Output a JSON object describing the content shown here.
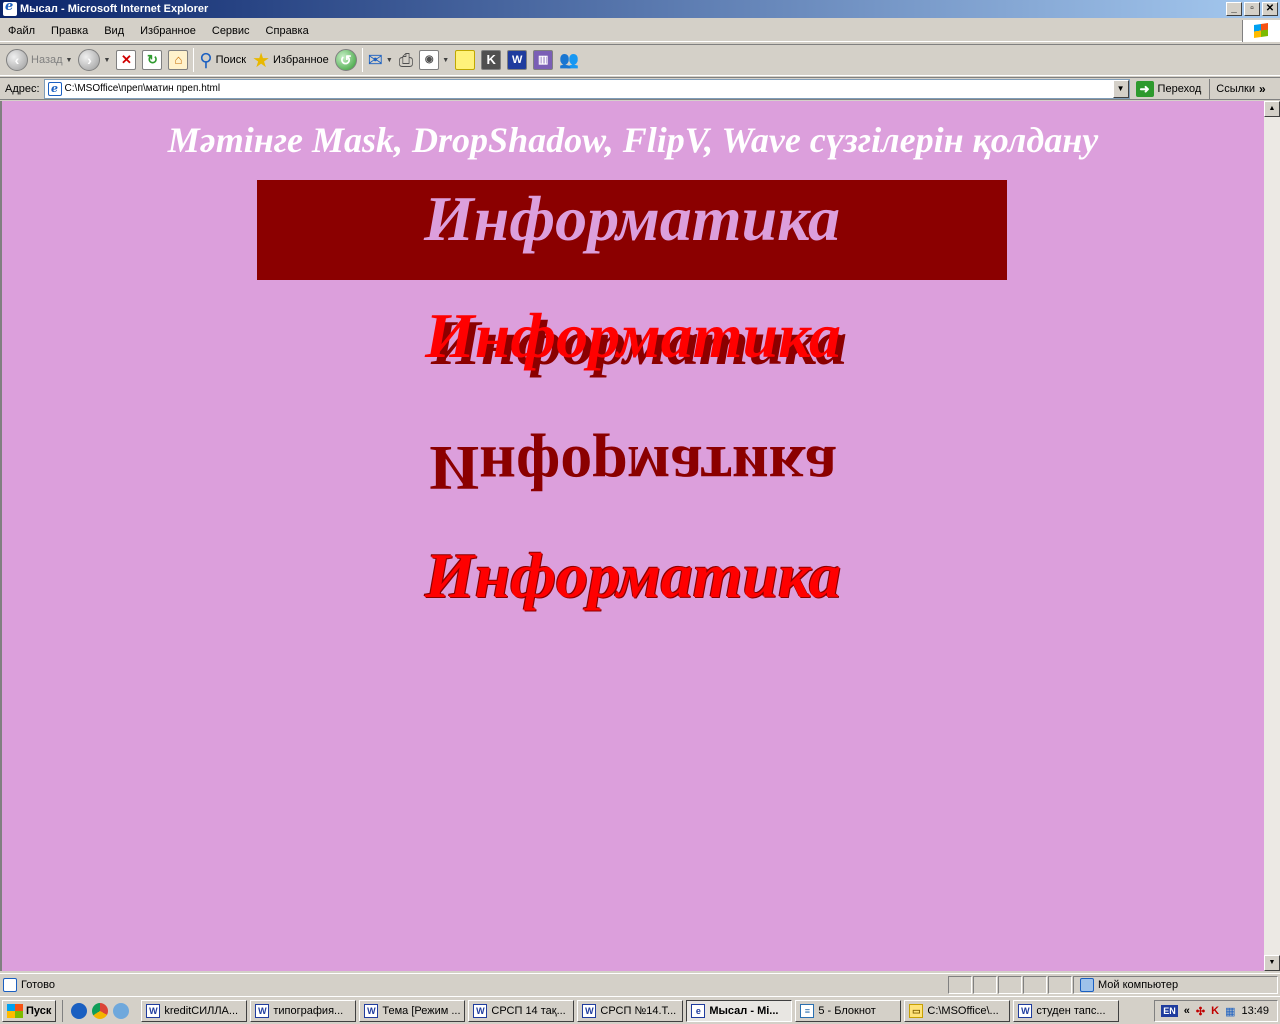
{
  "window": {
    "title": "Мысал - Microsoft Internet Explorer",
    "controls": [
      "_",
      "▫",
      "✕"
    ]
  },
  "menu": [
    "Файл",
    "Правка",
    "Вид",
    "Избранное",
    "Сервис",
    "Справка"
  ],
  "toolbar": {
    "back_label": "Назад",
    "search_label": "Поиск",
    "favorites_label": "Избранное"
  },
  "address": {
    "label": "Адрес:",
    "value": "C:\\MSOffice\\преп\\матин преп.html",
    "go_label": "Переход",
    "links_label": "Ссылки"
  },
  "page": {
    "background": "#dc9fdc",
    "heading": "Мәтінге Mask, DropShadow, FlipV, Wave сүзгілерін қолдану",
    "mask_word": "Информатика",
    "shadow_word": "Информатика",
    "flip_word": "Информатика",
    "wave_word": "Информатика",
    "colors": {
      "dark_red": "#8b0000",
      "red": "#ff0000",
      "white": "#ffffff"
    }
  },
  "status": {
    "text": "Готово",
    "zone": "Мой компьютер"
  },
  "taskbar": {
    "start_label": "Пуск",
    "tasks": [
      "kreditСИЛЛА...",
      "типография...",
      "Тема [Режим ...",
      "СРСП 14 тақ...",
      "СРСП №14.Т...",
      "Мысал - Mi...",
      "5 - Блокнот",
      "C:\\MSOffice\\...",
      "студен тапс..."
    ],
    "active_index": 5,
    "lang": "EN",
    "clock": "13:49"
  }
}
